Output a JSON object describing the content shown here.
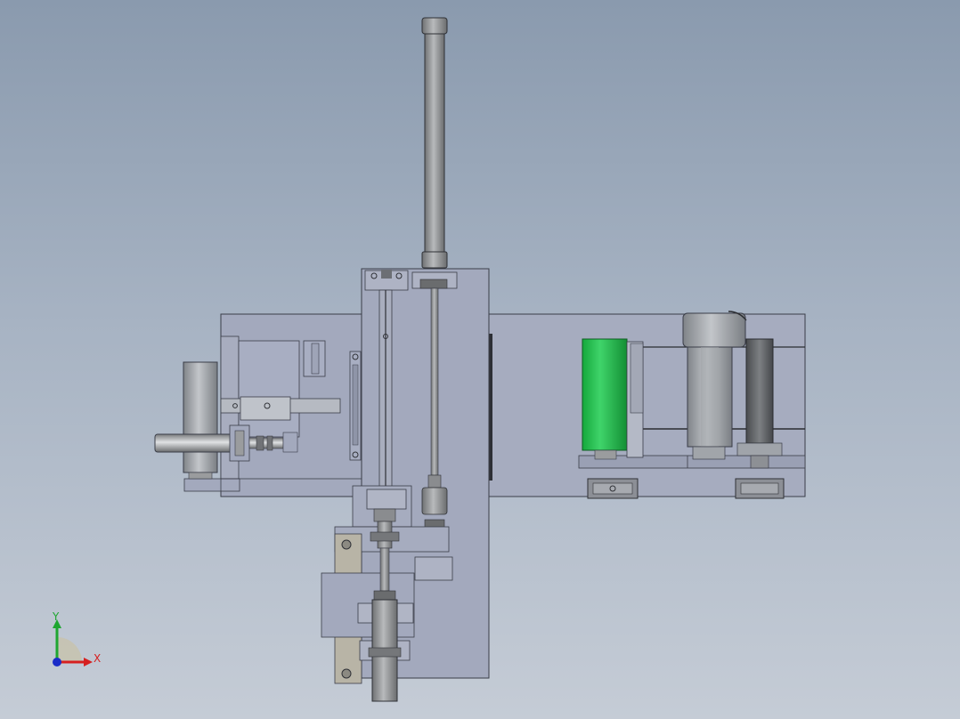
{
  "viewport": {
    "background_top": "#8a9aae",
    "background_bottom": "#c5ccd6"
  },
  "triad": {
    "x_label": "X",
    "y_label": "Y",
    "x_color": "#d62020",
    "y_color": "#1fa631",
    "z_color": "#1a2cc8"
  },
  "model": {
    "plate_color": "#a3a9bd",
    "accent_color": "#1fb646",
    "steel_color": "#9a9c9e",
    "dark_steel_color": "#6b6d70"
  }
}
